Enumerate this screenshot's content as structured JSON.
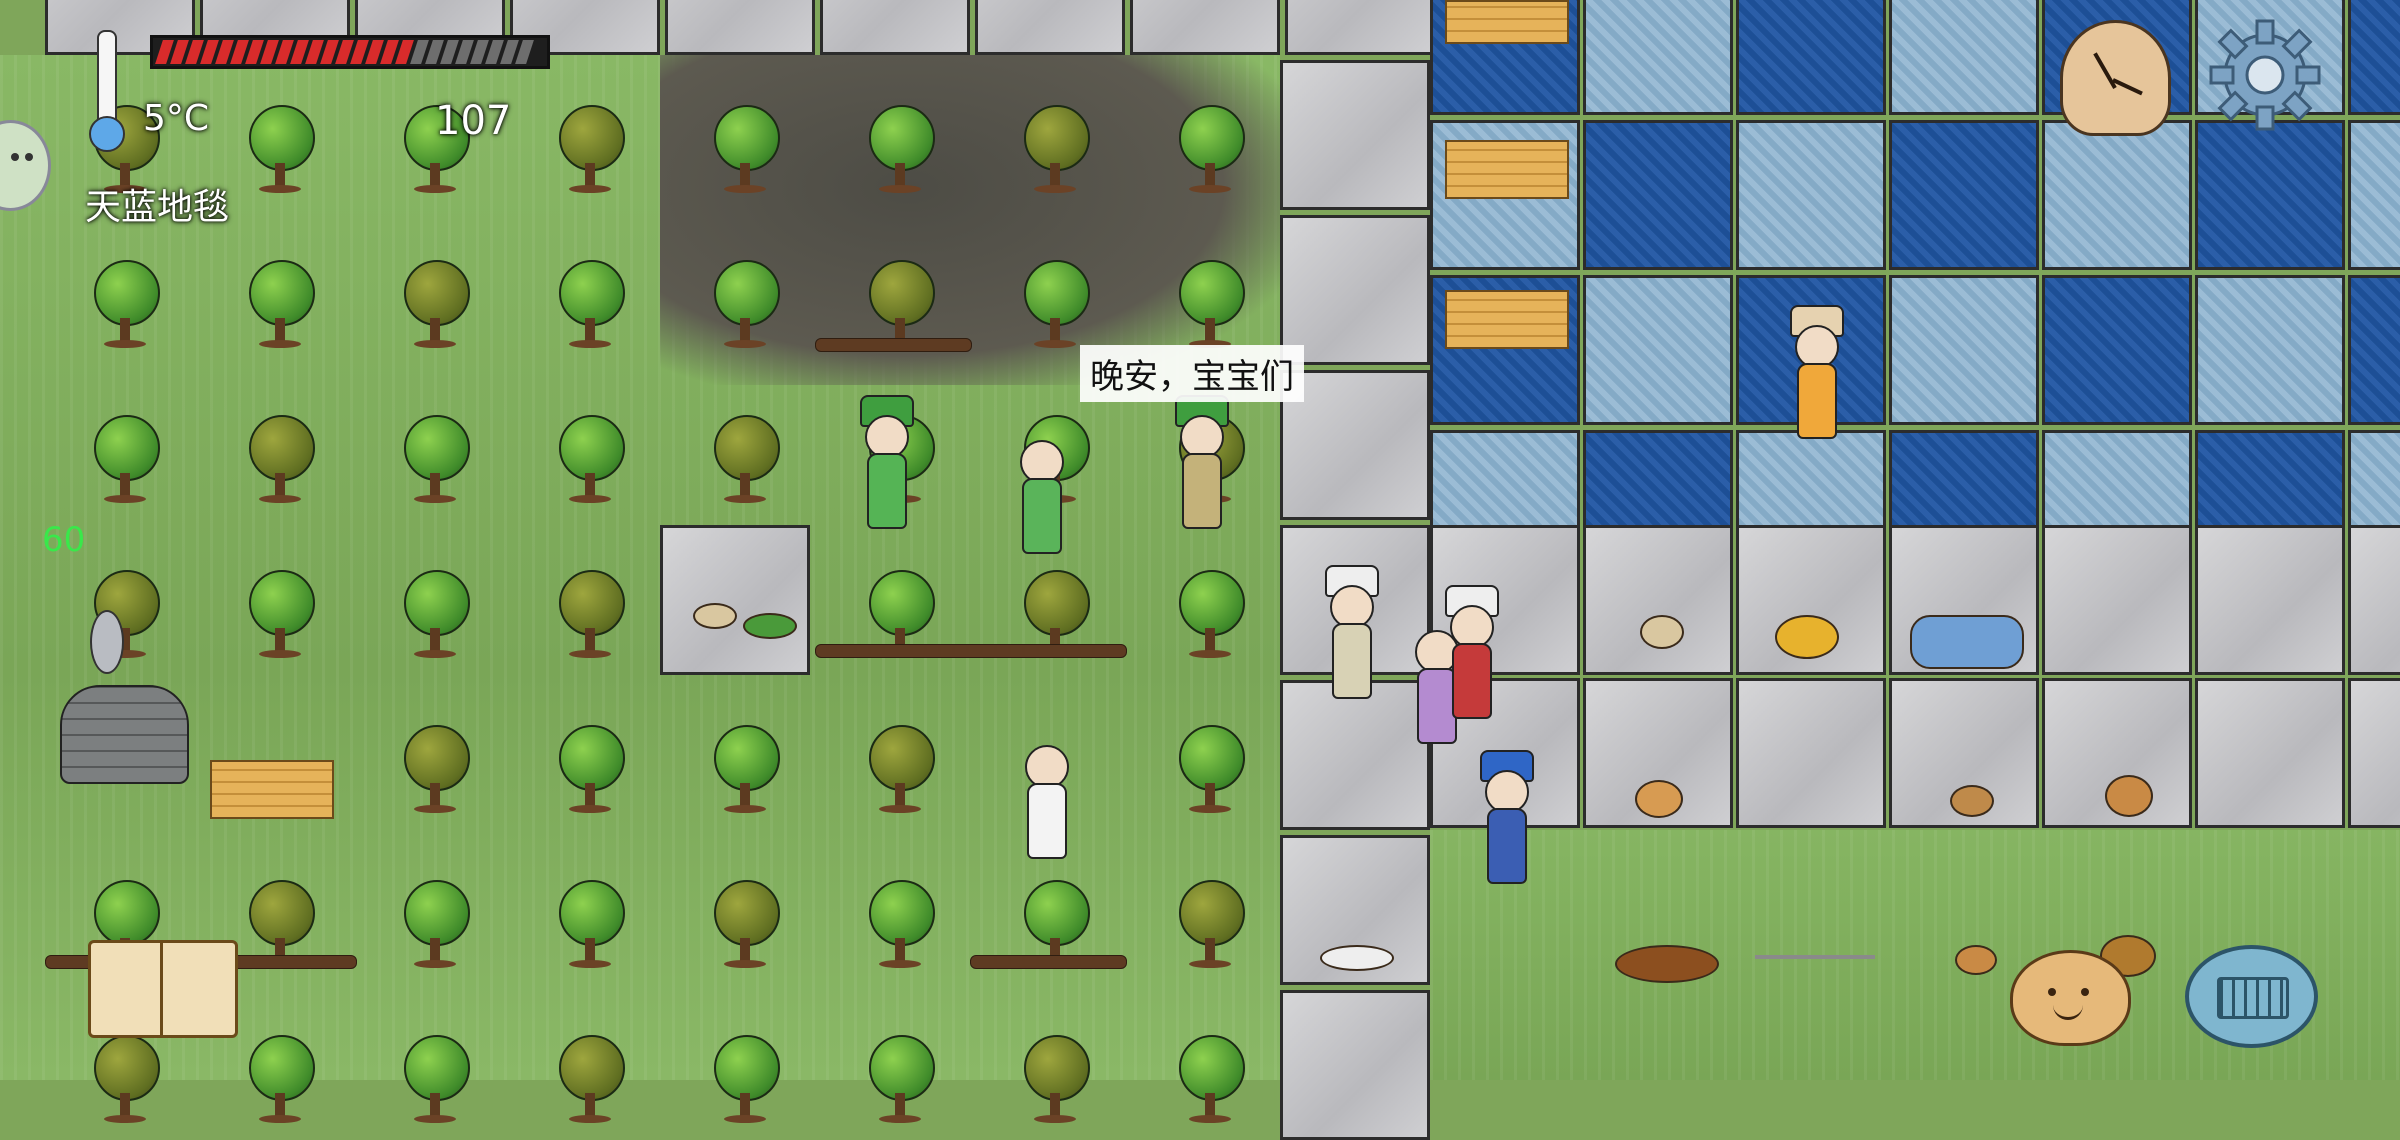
{
  "hud": {
    "temperature": "5°C",
    "food_count": "107",
    "held_item": "天蓝地毯",
    "fps": "60",
    "food_meter": {
      "filled": 17,
      "total": 25,
      "fill_color": "#d92b2b",
      "empty_color": "#6e6e6e"
    }
  },
  "speech": {
    "text": "晚安，宝宝们"
  },
  "icons": {
    "thermometer": "thermometer-icon",
    "clock": "clock-icon",
    "settings": "gear-icon",
    "chat": "smiley-face-icon",
    "keyboard": "keyboard-icon",
    "book": "recipe-book-icon",
    "emote": "emote-face-icon"
  },
  "colors": {
    "grass": "#7fa65a",
    "carpet_dark": "#1d4f96",
    "carpet_light": "#9bbcd5",
    "stone_floor": "#c9c9cc"
  }
}
